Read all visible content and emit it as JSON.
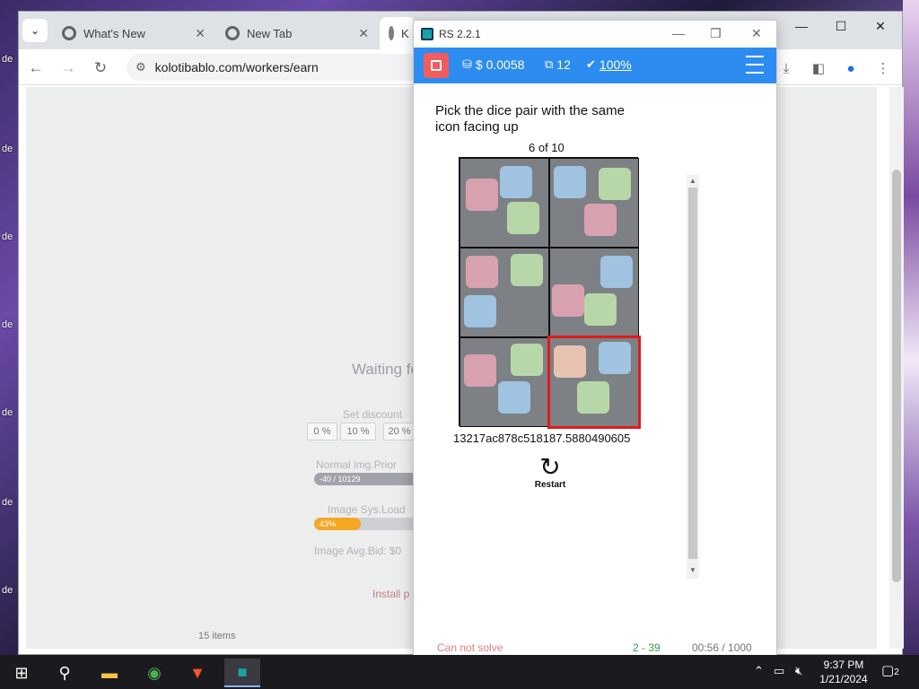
{
  "browser": {
    "tabs": [
      {
        "label": "What's New"
      },
      {
        "label": "New Tab"
      },
      {
        "label": "K"
      }
    ],
    "url": "kolotibablo.com/workers/earn",
    "window_controls": {
      "minimize": "—",
      "maximize": "☐",
      "close": "✕"
    }
  },
  "page": {
    "waiting": "Waiting fo",
    "discount_label": "Set discount",
    "discounts": [
      "0 %",
      "10 %",
      "20 %"
    ],
    "normal_label": "Normal img.Prior",
    "normal_value": "-40 / 10129",
    "sysload_label": "Image Sys.Load",
    "sysload_value": "43%",
    "sysload_level": 0.43,
    "avgbid_label": "Image Avg.Bid: $0",
    "install": "Install p",
    "items": "15 items"
  },
  "popup": {
    "title": "RS 2.2.1",
    "balance": "$ 0.0058",
    "count": "12",
    "rate": "100%",
    "question": "Pick the dice pair with the same icon facing up",
    "progress": "6 of 10",
    "hash": "13217ac878c518187.5880490605",
    "restart": "Restart",
    "footer_cant": "Can not solve",
    "footer_count": "2 - 39",
    "footer_time": "00:56 / 1000"
  },
  "taskbar": {
    "time": "9:37 PM",
    "date": "1/21/2024",
    "notifications": "2"
  },
  "colors": {
    "accent": "#2d8cf0",
    "stop": "#f25c5c",
    "selection": "#e01b1b",
    "progress_fill": "#f5a623"
  }
}
